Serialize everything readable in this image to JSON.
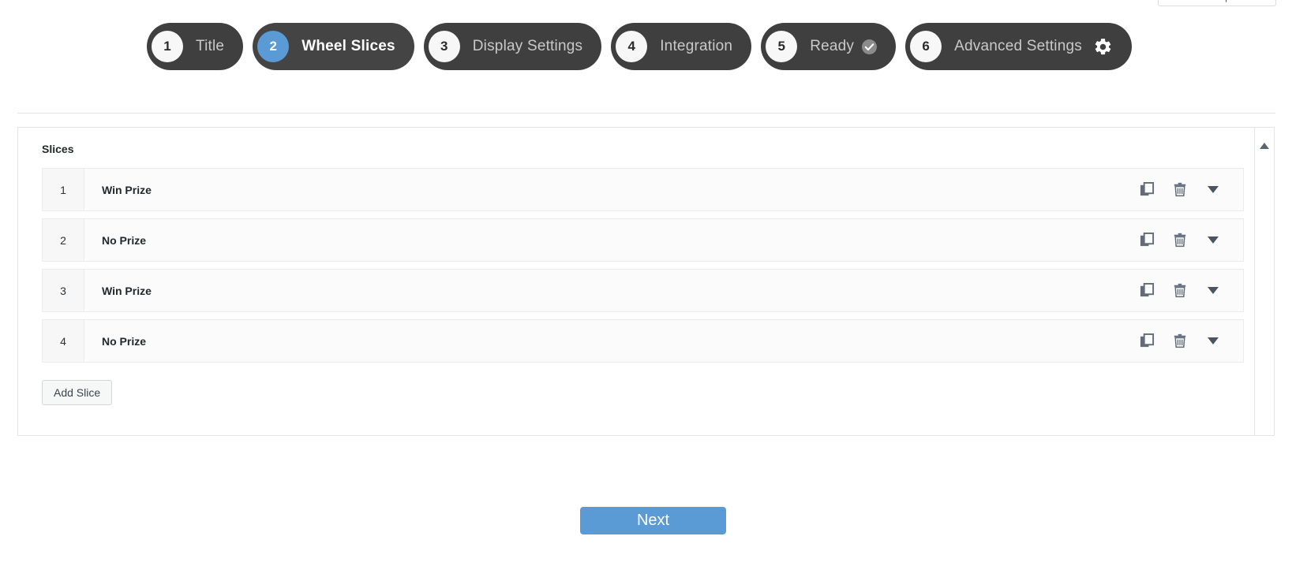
{
  "screen_options": {
    "label": "Screen Options"
  },
  "stepper": {
    "steps": [
      {
        "num": "1",
        "label": "Title",
        "active": false,
        "icon": ""
      },
      {
        "num": "2",
        "label": "Wheel Slices",
        "active": true,
        "icon": ""
      },
      {
        "num": "3",
        "label": "Display Settings",
        "active": false,
        "icon": ""
      },
      {
        "num": "4",
        "label": "Integration",
        "active": false,
        "icon": ""
      },
      {
        "num": "5",
        "label": "Ready",
        "active": false,
        "icon": "check-circle-icon"
      },
      {
        "num": "6",
        "label": "Advanced Settings",
        "active": false,
        "icon": "gear-icon"
      }
    ]
  },
  "panel": {
    "title": "Slices",
    "rows": [
      {
        "index": "1",
        "label": "Win Prize"
      },
      {
        "index": "2",
        "label": "No Prize"
      },
      {
        "index": "3",
        "label": "Win Prize"
      },
      {
        "index": "4",
        "label": "No Prize"
      }
    ],
    "row_actions": [
      "duplicate-icon",
      "trash-icon",
      "chevron-down-icon"
    ],
    "add_slice_label": "Add Slice",
    "rail_icon": "caret-up-icon"
  },
  "footer": {
    "next_label": "Next"
  },
  "colors": {
    "accent_blue": "#5b9bd5",
    "step_dark": "#3f3f3f",
    "icon_gray": "#5f6c7b",
    "panel_border": "#e5e5e5"
  }
}
